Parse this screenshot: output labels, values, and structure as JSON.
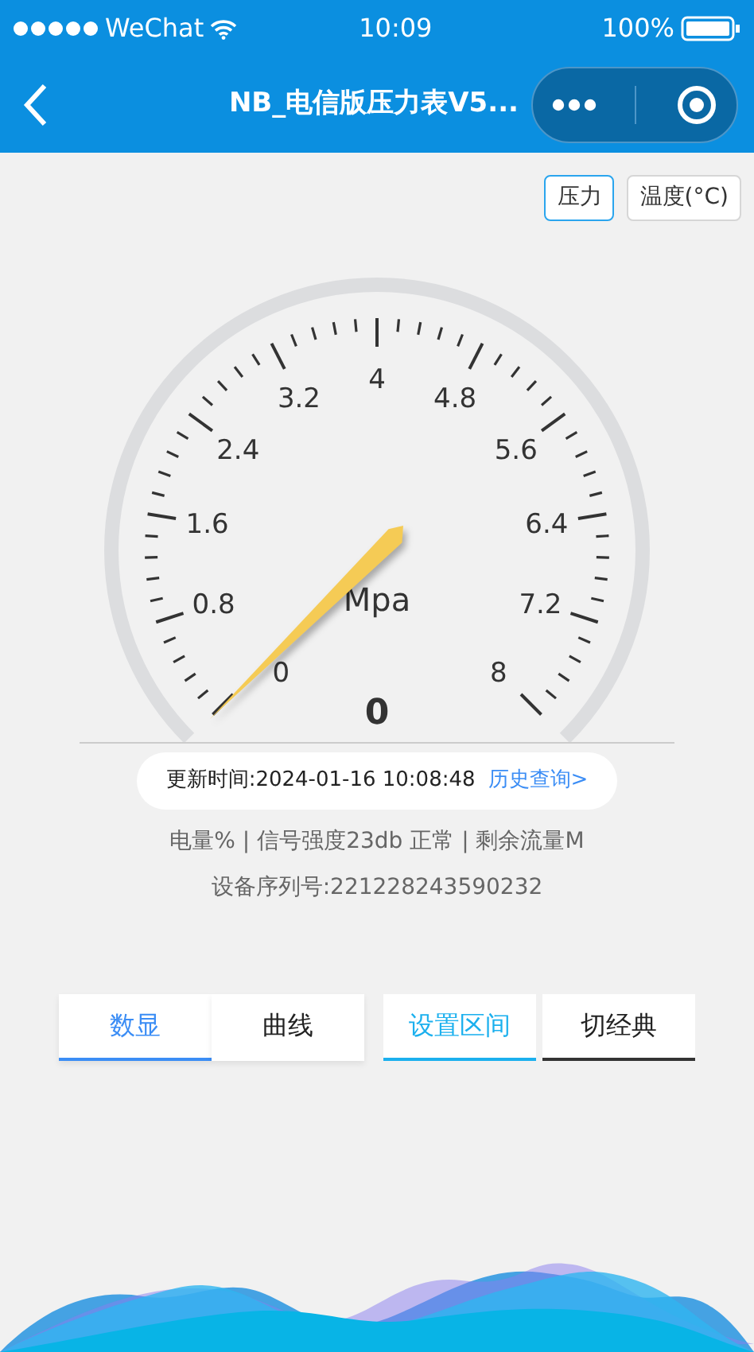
{
  "status_bar": {
    "carrier": "WeChat",
    "time": "10:09",
    "battery": "100%"
  },
  "nav": {
    "title": "NB_电信版压力表V5..."
  },
  "mode_toggle": [
    {
      "label": "压力",
      "selected": true
    },
    {
      "label": "温度(°C)",
      "selected": false
    }
  ],
  "gauge": {
    "scale_labels": [
      "0",
      "0.8",
      "1.6",
      "2.4",
      "3.2",
      "4",
      "4.8",
      "5.6",
      "6.4",
      "7.2",
      "8"
    ],
    "unit": "Mpa",
    "reading": "0"
  },
  "update": {
    "text": "更新时间:2024-01-16 10:08:48",
    "link": "历史查询>"
  },
  "status_line": "电量% | 信号强度23db 正常 | 剩余流量M",
  "serial": "设备序列号:221228243590232",
  "view_tabs": [
    {
      "label": "数显",
      "selected": true
    },
    {
      "label": "曲线",
      "selected": false
    }
  ],
  "action_tabs": [
    {
      "label": "设置区间",
      "selected": true
    },
    {
      "label": "切经典",
      "selected": false
    }
  ]
}
